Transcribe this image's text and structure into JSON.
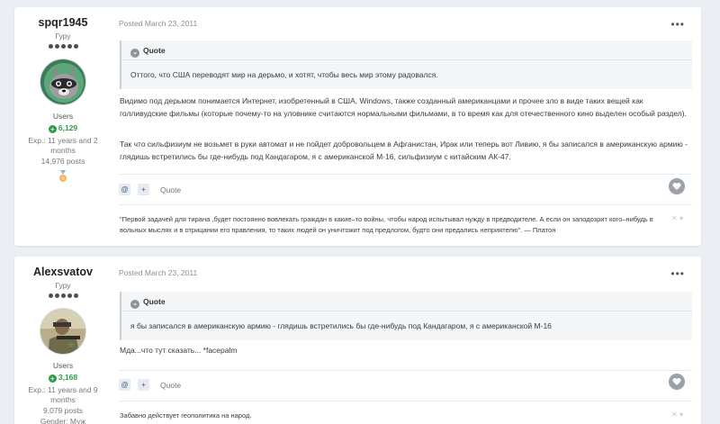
{
  "posts": [
    {
      "author": {
        "name": "spqr1945",
        "rank": "Гуру",
        "group": "Users",
        "reputation": "6,129",
        "joined": "Exp.: 11 years and 2 months",
        "posts_count": "14,976 posts"
      },
      "date": "Posted March 23, 2011",
      "quote": {
        "label": "Quote",
        "text": "Оттого, что США переводят мир на дерьмо, и хотят, чтобы весь мир этому радовался."
      },
      "paragraphs": [
        "Видимо под дерьмом понимается Интернет, изобретенный в США, Windows, также созданный американцами и прочее зло в виде таких вещей как голливудские фильмы (которые почему-то на уловнике считаются нормальными фильмами, в то время как для отечественного кино выделен особый раздел).",
        "Так что сильфизиум не возьмет в руки автомат и не пойдет добровольцем в Афганистан, Ирак или теперь вот Ливию, я бы записался в американскую армию - глядишь встретились бы где-нибудь под Кандагаром, я с американской М-16, сильфизиум с китайским АК-47."
      ],
      "quote_action": "Quote",
      "signature": "\"Первой задачей для тирана ,будет постоянно вовлекать граждан в какие–то войны, чтобы народ испытывал нужду в предводителе. А если он заподозрит кого–нибудь в вольных мыслях и в отрицании его правления, то таких людей он уничтожит под предлогом, будто они предались неприятелю\". — Платон"
    },
    {
      "author": {
        "name": "Alexsvatov",
        "rank": "Гуру",
        "group": "Users",
        "reputation": "3,168",
        "joined": "Exp.: 11 years and 9 months",
        "posts_count": "9,079 posts",
        "gender": "Gender: Муж"
      },
      "date": "Posted March 23, 2011",
      "quote": {
        "label": "Quote",
        "text": "я бы записался в американскую армию - глядишь встретились бы где-нибудь под Кандагаром, я с американской М-16"
      },
      "paragraphs": [
        "Мда...что тут сказать... *facepalm"
      ],
      "quote_action": "Quote",
      "signature": "Забавно действует геополитика на народ."
    }
  ],
  "icons": {
    "more": "three-dots",
    "reputation": "plus-circle",
    "quote": "chevron-circle",
    "mention": "at-sign",
    "multiquote": "plus",
    "like": "heart",
    "close": "x"
  },
  "colors": {
    "reputation": "#2e9b4a",
    "background": "#ebeef2"
  }
}
